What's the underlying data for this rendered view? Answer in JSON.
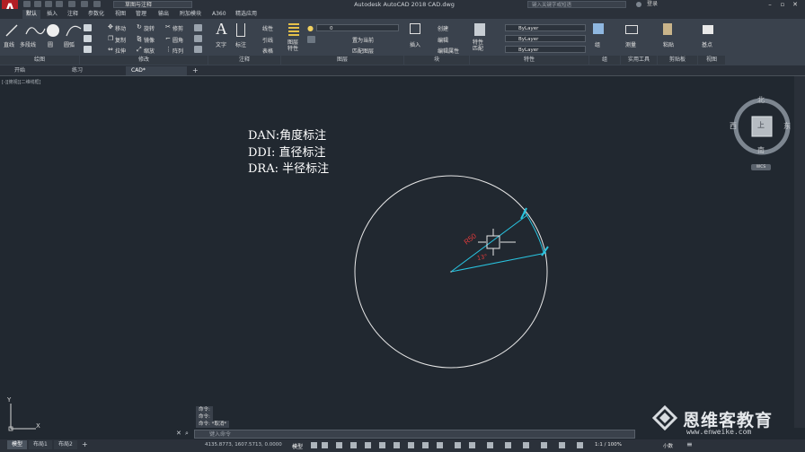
{
  "app": {
    "window_title": "Autodesk AutoCAD 2018    CAD.dwg",
    "workspace": "草图与注释",
    "search_placeholder": "键入关键字或短语",
    "sign_in": "登录",
    "logo_letter": "A"
  },
  "ribbon_tabs": [
    "默认",
    "插入",
    "注释",
    "参数化",
    "视图",
    "管理",
    "输出",
    "附加模块",
    "A360",
    "精选应用"
  ],
  "ribbon": {
    "draw": {
      "title": "绘图",
      "line": "直线",
      "polyline": "多段线",
      "circle": "圆",
      "arc": "圆弧"
    },
    "modify": {
      "title": "修改",
      "move": "移动",
      "copy": "复制",
      "stretch": "拉伸",
      "rotate": "旋转",
      "mirror": "镜像",
      "scale": "缩放",
      "trim": "修剪",
      "fillet": "圆角",
      "array": "阵列"
    },
    "annotation": {
      "title": "注释",
      "text": "文字",
      "dimension": "标注",
      "linear": "线性",
      "leader": "引线",
      "table": "表格"
    },
    "layers": {
      "title": "图层",
      "layer_properties": "图层\n特性",
      "current_layer": "0",
      "make_current": "置为当前",
      "match_layer": "匹配图层"
    },
    "block": {
      "title": "块",
      "insert": "插入",
      "create": "创建",
      "edit": "编辑",
      "edit_attributes": "编辑属性"
    },
    "properties": {
      "title": "特性",
      "match": "特性\n匹配",
      "color": "ByLayer",
      "linetype": "ByLayer",
      "lineweight": "ByLayer"
    },
    "groups": {
      "title": "组",
      "group": "组"
    },
    "utilities": {
      "title": "实用工具",
      "measure": "测量"
    },
    "clipboard": {
      "title": "剪贴板",
      "paste": "粘贴"
    },
    "view": {
      "title": "视图",
      "base": "基点"
    }
  },
  "file_tabs": [
    "开始",
    "练习",
    "CAD*"
  ],
  "viewport_controls": "[-][俯视][二维线框]",
  "notes": [
    "DAN:角度标注",
    "DDI: 直径标注",
    "DRA: 半径标注"
  ],
  "dimension_labels": {
    "radius": "R50",
    "angle": "13°"
  },
  "viewcube": {
    "north": "北",
    "south": "南",
    "east": "东",
    "west": "西",
    "face": "上",
    "wcs": "WCS"
  },
  "ucs": {
    "x": "X",
    "y": "Y"
  },
  "command_history": [
    "命令:",
    "命令:",
    "命令: *取消*"
  ],
  "command_placeholder": "键入命令",
  "layout_tabs": [
    "模型",
    "布局1",
    "布局2"
  ],
  "status": {
    "coordinates": "4135.8773, 1607.5713, 0.0000",
    "mode": "模型",
    "annotation_scale": "1:1 / 100%",
    "small": "小数"
  },
  "watermark": {
    "brand": "恩维客教育",
    "url": "www.enweike.com"
  },
  "colors": {
    "background": "#212830",
    "ribbon": "#3a424d",
    "dimension": "#29c4e0",
    "dim_text": "#e33b3b",
    "logo": "#b21e24"
  }
}
